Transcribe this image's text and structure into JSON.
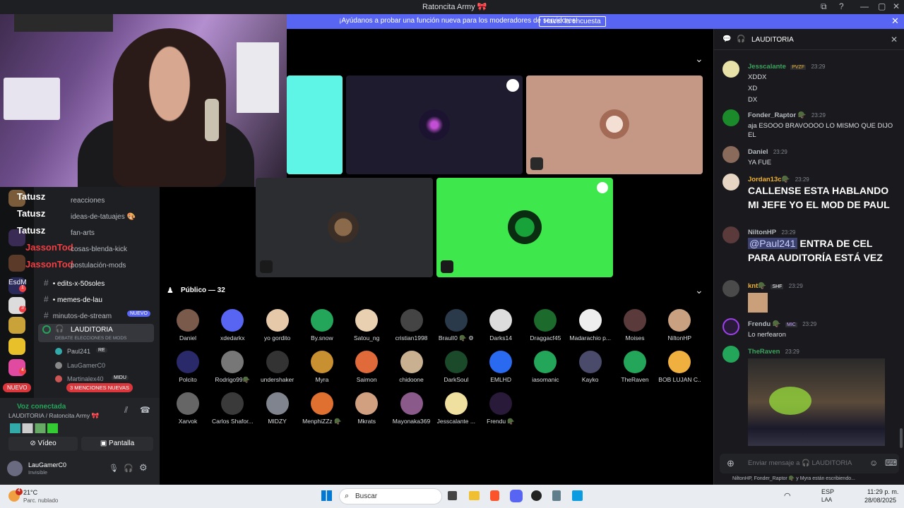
{
  "window": {
    "title": "Ratoncita Army 🎀",
    "controls": [
      "⧉",
      "?",
      "—",
      "▢",
      "✕"
    ]
  },
  "banner": {
    "text": "¡Ayúdanos a probar una función nueva para los moderadores de servidores!",
    "button": "Hacer la encuesta",
    "close": "✕"
  },
  "stage": {
    "collapse": "⌄"
  },
  "sidebar": {
    "channels": [
      {
        "label": "reacciones"
      },
      {
        "label": "ideas-de-tatuajes 🎨"
      },
      {
        "label": "fan-arts"
      },
      {
        "label": "cosas-blenda-kick"
      },
      {
        "label": "postulación-mods"
      },
      {
        "label": "edits-x-50soles"
      },
      {
        "label": "memes-de-lau"
      },
      {
        "label": "minutos-de-stream",
        "badge": "NUEVO"
      }
    ],
    "overlay_names": [
      "Tatusz",
      "Tatusz",
      "Tatusz",
      "JassonTod",
      "JassonTod",
      "EsdM"
    ],
    "server_badges": [
      "1",
      "3",
      "4"
    ],
    "voice_channel": {
      "name": "LAUDITORIA",
      "topic": "DEBATE ELECCIONES DE MODS"
    },
    "voice_members": [
      "Paul241",
      "LauGamerC0",
      "Martinalex40"
    ],
    "voice_member_tags": [
      "RE",
      "MIDU"
    ],
    "mentions_pill": "3 MENCIONES NUEVAS",
    "nuevo_pill": "NUEVO",
    "voice_status": {
      "label": "Voz conectada",
      "channel": "LAUDITORIA / Ratoncita Army 🎀"
    },
    "video_button": "Vídeo",
    "screen_button": "Pantalla",
    "user": {
      "name": "LauGamerC0",
      "status": "Invisible"
    }
  },
  "public": {
    "header": "Público — 32",
    "collapse": "⌄",
    "members": [
      "Daniel",
      "xdedarkx",
      "yo gordito",
      "By.snow",
      "Satou_ng",
      "cristian1998",
      "BraulI0 🪖 ⚙",
      "Darks14",
      "Draggacf45",
      "Madarachio p...",
      "Moises",
      "NiltonHP",
      "Polcito",
      "Rodrigo99🪖",
      "undershaker",
      "Myra",
      "Saimon",
      "chidoone",
      "DarkSoul",
      "EMLHD",
      "iasomanic",
      "Kayko",
      "TheRaven",
      "BOB LUJAN C...",
      "Xarvok",
      "Carlos Shafor...",
      "MIDZY",
      "MenphiZZz 🪖",
      "Mkrats",
      "Mayonaka369",
      "Jesscalante ...",
      "Frendu 🪖"
    ]
  },
  "chat": {
    "header": "LAUDITORIA",
    "close": "✕",
    "messages": [
      {
        "user": "Jesscalante",
        "tag": "PVZF",
        "time": "23:29",
        "lines": [
          "XDDX",
          "XD",
          "DX"
        ],
        "color": "#3ba55d"
      },
      {
        "user": "Fonder_Raptor 🪖",
        "time": "23:29",
        "lines": [
          "aja ESOOO BRAVOOOO LO MISMO QUE DIJO EL"
        ],
        "color": "#b5bac1"
      },
      {
        "user": "Daniel",
        "time": "23:29",
        "lines": [
          "YA FUE"
        ],
        "color": "#b5bac1"
      },
      {
        "user": "Jordan13c🪖",
        "time": "23:29",
        "big": "CALLENSE ESTA HABLANDO MI JEFE YO EL MOD DE PAUL",
        "color": "#f0b232"
      },
      {
        "user": "NiltonHP",
        "time": "23:29",
        "mention": "@Paul241",
        "big": "ENTRA DE CEL PARA AUDITORÍA ESTÁ VEZ",
        "color": "#b5bac1"
      },
      {
        "user": "knt🪖",
        "tag": "SHF",
        "time": "23:29",
        "color": "#f0b232"
      },
      {
        "user": "Frendu 🪖",
        "tag": "MIC",
        "time": "23:29",
        "lines": [
          "Lo nerfearon"
        ],
        "color": "#b5bac1"
      },
      {
        "user": "TheRaven",
        "time": "23:29",
        "color": "#3ba55d"
      }
    ],
    "input_placeholder": "Enviar mensaje a 🎧 LAUDITORIA",
    "typing": "NiltonHP, Fonder_Raptor 🪖 y Myra están escribiendo..."
  },
  "taskbar": {
    "weather_temp": "21°C",
    "weather_desc": "Parc. nublado",
    "weather_badge": "4",
    "search": "Buscar",
    "lang": "ESP",
    "lang2": "LAA",
    "time": "11:29 p. m.",
    "date": "28/08/2025"
  }
}
